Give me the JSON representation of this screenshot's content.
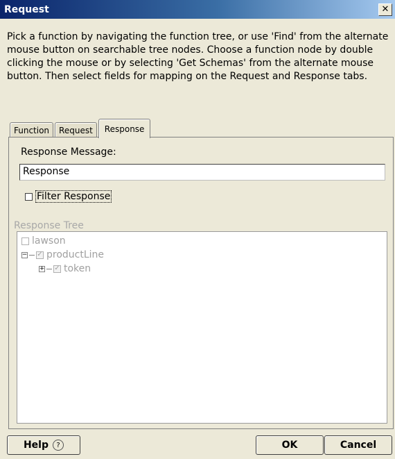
{
  "window": {
    "title": "Request",
    "close_glyph": "✕"
  },
  "description": "Pick a function by navigating the function tree, or use 'Find' from the alternate mouse button on searchable tree nodes. Choose a function node by double clicking the mouse or by selecting 'Get Schemas' from the alternate mouse button. Then select fields for mapping on the Request and Response tabs.",
  "tabs": [
    {
      "label": "Function",
      "active": false
    },
    {
      "label": "Request",
      "active": false
    },
    {
      "label": "Response",
      "active": true
    }
  ],
  "response": {
    "message_label": "Response Message:",
    "message_value": "Response",
    "filter_label": "Filter Response",
    "filter_checked": false
  },
  "tree": {
    "label": "Response Tree",
    "nodes": [
      {
        "label": "lawson",
        "checked": false,
        "expander": ""
      },
      {
        "label": "productLine",
        "checked": true,
        "expander": "−"
      },
      {
        "label": "token",
        "checked": true,
        "expander": "+"
      }
    ]
  },
  "buttons": {
    "help_label": "Help",
    "help_icon": "?",
    "ok_label": "OK",
    "cancel_label": "Cancel"
  }
}
